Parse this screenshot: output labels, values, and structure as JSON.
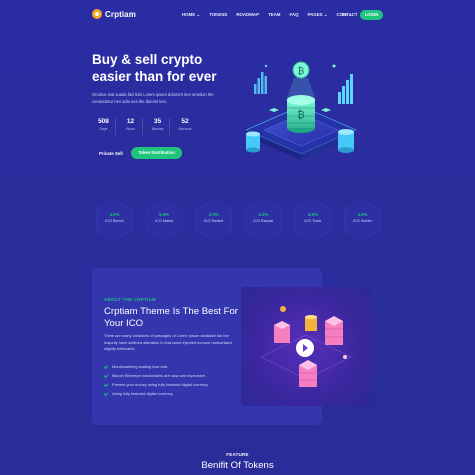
{
  "brand": {
    "name": "Crptiam",
    "logo_icon": "coin-logo-icon"
  },
  "nav": {
    "items": [
      "HOME",
      "TOKENS",
      "ROADMAP",
      "TEAM",
      "FAQ",
      "PAGES",
      "CONTACT"
    ],
    "lang": "En",
    "login": "LOGIN"
  },
  "hero": {
    "title": "Buy & sell crypto easier than for ever",
    "description": "Gruntus mai suada faci lisis Lorem ipsum dolarorit mor ametion the consectetur neo adio sea the dummi text.",
    "countdown": [
      {
        "value": "508",
        "label": "Days"
      },
      {
        "value": "12",
        "label": "Hours"
      },
      {
        "value": "35",
        "label": "Minutes"
      },
      {
        "value": "52",
        "label": "Seconds"
      }
    ],
    "private_sell": "Private Sell",
    "token_button": "Token Distribution"
  },
  "ico_stats": [
    {
      "percent": "4.0%",
      "label": "ICO Bench"
    },
    {
      "percent": "5.5%",
      "label": "ICO Marks"
    },
    {
      "percent": "4.0%",
      "label": "ICO Ranker"
    },
    {
      "percent": "4.2%",
      "label": "ICO Bazaar"
    },
    {
      "percent": "4.5%",
      "label": "ICO Track"
    },
    {
      "percent": "4.0%",
      "label": "ICO Holder"
    }
  ],
  "about": {
    "kicker": "ABOUT THE CRPTIAM",
    "title": "Crptiam Theme Is The Best For Your ICO",
    "description": "There are many variations of passages of Lorem Ipsum available but the majority have suffered alteration in that some injected humour randomised slightly believable.",
    "list": [
      "Mouthwatering leading how real.",
      "Bitcoin Ethereum blockchains are slow and expensive.",
      "Present your money using fully featured digital currency.",
      "Using fully featured digital currency."
    ]
  },
  "feature": {
    "kicker": "FEATURE",
    "title": "Benifit Of Tokens"
  },
  "colors": {
    "accent": "#1fc47d",
    "background": "#2b2d9e",
    "logo": "#f5a623"
  }
}
